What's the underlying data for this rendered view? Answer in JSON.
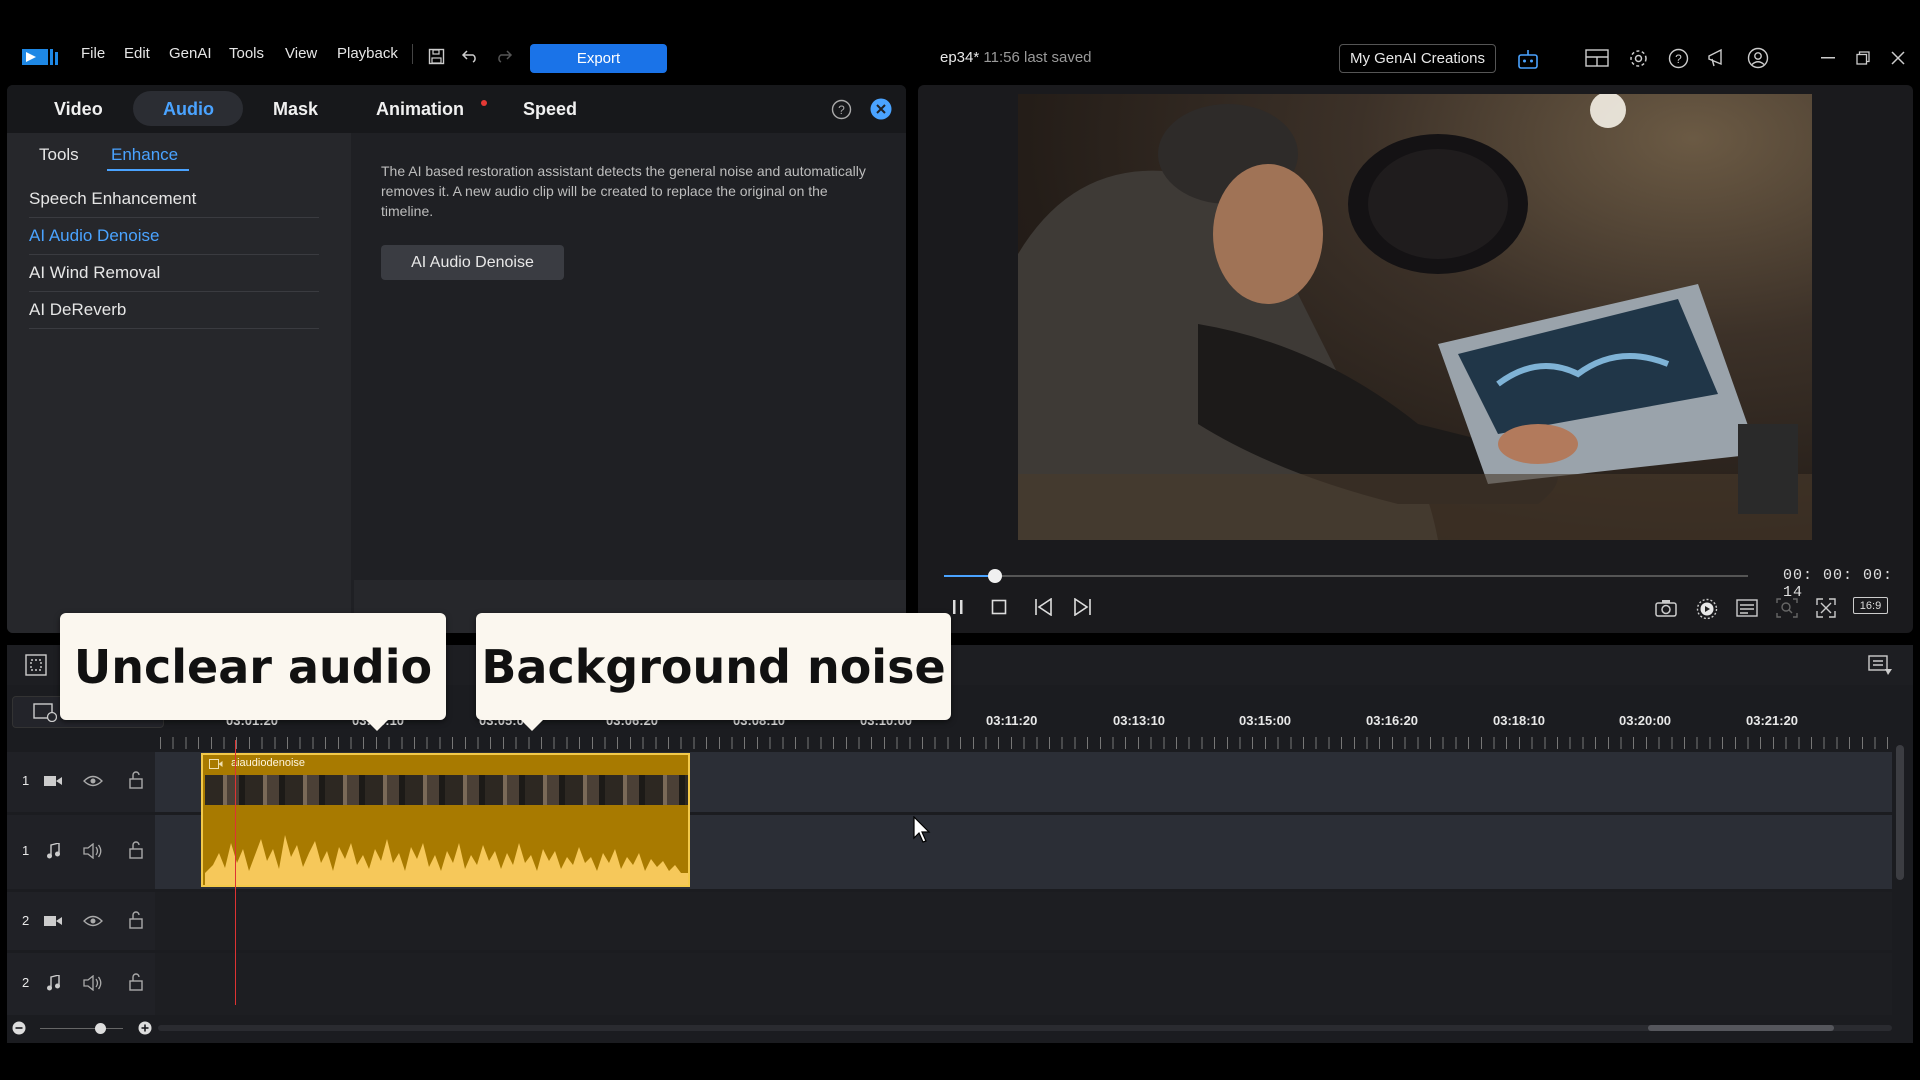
{
  "menu": [
    "File",
    "Edit",
    "GenAI",
    "Tools",
    "View",
    "Playback"
  ],
  "export_label": "Export",
  "project_name": "ep34*",
  "last_saved": "11:56 last saved",
  "genai_creations_label": "My GenAI Creations",
  "panel": {
    "tabs": [
      "Video",
      "Audio",
      "Mask",
      "Animation",
      "Speed"
    ],
    "active_tab": "Audio",
    "subtabs": [
      "Tools",
      "Enhance"
    ],
    "active_subtab": "Enhance",
    "items": [
      "Speech Enhancement",
      "AI Audio Denoise",
      "AI Wind Removal",
      "AI DeReverb"
    ],
    "selected_item": "AI Audio Denoise",
    "description": "The AI based restoration assistant detects the general noise and automatically removes it. A new audio clip will be created to replace the original on the timeline.",
    "action_button": "AI Audio Denoise"
  },
  "preview": {
    "timecode": "00: 00: 00: 14",
    "aspect": "16:9",
    "progress": 0.063
  },
  "timeline": {
    "ruler": [
      "03:01:20",
      "03:03:10",
      "03:05:00",
      "03:06:20",
      "03:08:10",
      "03:10:00",
      "03:11:20",
      "03:13:10",
      "03:15:00",
      "03:16:20",
      "03:18:10",
      "03:20:00",
      "03:21:20"
    ],
    "tracks": [
      {
        "num": "1",
        "type": "video"
      },
      {
        "num": "1",
        "type": "audio"
      },
      {
        "num": "2",
        "type": "video"
      },
      {
        "num": "2",
        "type": "audio"
      }
    ],
    "clip_name": "aiaudiodenoise"
  },
  "callouts": [
    "Unclear audio",
    "Background noise"
  ],
  "colors": {
    "accent": "#1a73e8",
    "clip": "#a87a00",
    "selected": "#4aa3ff"
  }
}
